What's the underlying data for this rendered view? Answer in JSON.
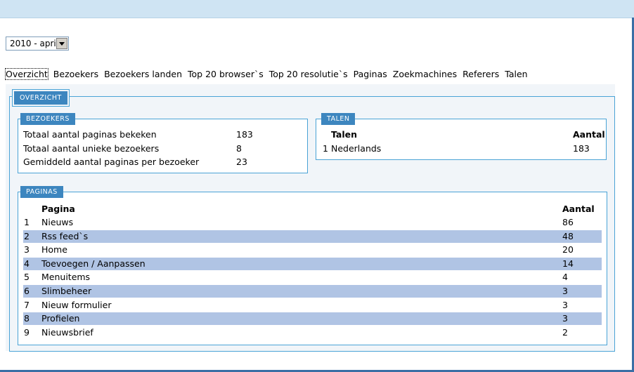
{
  "period_select": {
    "value": "2010 - april"
  },
  "nav": [
    "Overzicht",
    "Bezoekers",
    "Bezoekers landen",
    "Top 20 browser`s",
    "Top 20 resolutie`s",
    "Paginas",
    "Zoekmachines",
    "Referers",
    "Talen"
  ],
  "overzicht": {
    "legend": "OVERZICHT",
    "bezoekers": {
      "legend": "BEZOEKERS",
      "rows": [
        {
          "label": "Totaal aantal paginas bekeken",
          "value": "183"
        },
        {
          "label": "Totaal aantal unieke bezoekers",
          "value": "8"
        },
        {
          "label": "Gemiddeld aantal paginas per bezoeker",
          "value": "23"
        }
      ]
    },
    "talen": {
      "legend": "TALEN",
      "headers": {
        "col1": "Talen",
        "col2": "Aantal"
      },
      "rows": [
        {
          "nr": "1",
          "name": "Nederlands",
          "count": "183"
        }
      ]
    },
    "paginas": {
      "legend": "PAGINAS",
      "headers": {
        "col1": "Pagina",
        "col2": "Aantal"
      },
      "rows": [
        {
          "nr": "1",
          "name": "Nieuws",
          "count": "86"
        },
        {
          "nr": "2",
          "name": "Rss feed`s",
          "count": "48"
        },
        {
          "nr": "3",
          "name": "Home",
          "count": "20"
        },
        {
          "nr": "4",
          "name": "Toevoegen / Aanpassen",
          "count": "14"
        },
        {
          "nr": "5",
          "name": "Menuitems",
          "count": "4"
        },
        {
          "nr": "6",
          "name": "Slimbeheer",
          "count": "3"
        },
        {
          "nr": "7",
          "name": "Nieuw formulier",
          "count": "3"
        },
        {
          "nr": "8",
          "name": "Profielen",
          "count": "3"
        },
        {
          "nr": "9",
          "name": "Nieuwsbrief",
          "count": "2"
        }
      ]
    }
  },
  "colors": {
    "accent": "#3d86bf",
    "border": "#4aa3d6",
    "row_highlight": "#b0c4e4",
    "topbar": "#cfe4f3"
  }
}
